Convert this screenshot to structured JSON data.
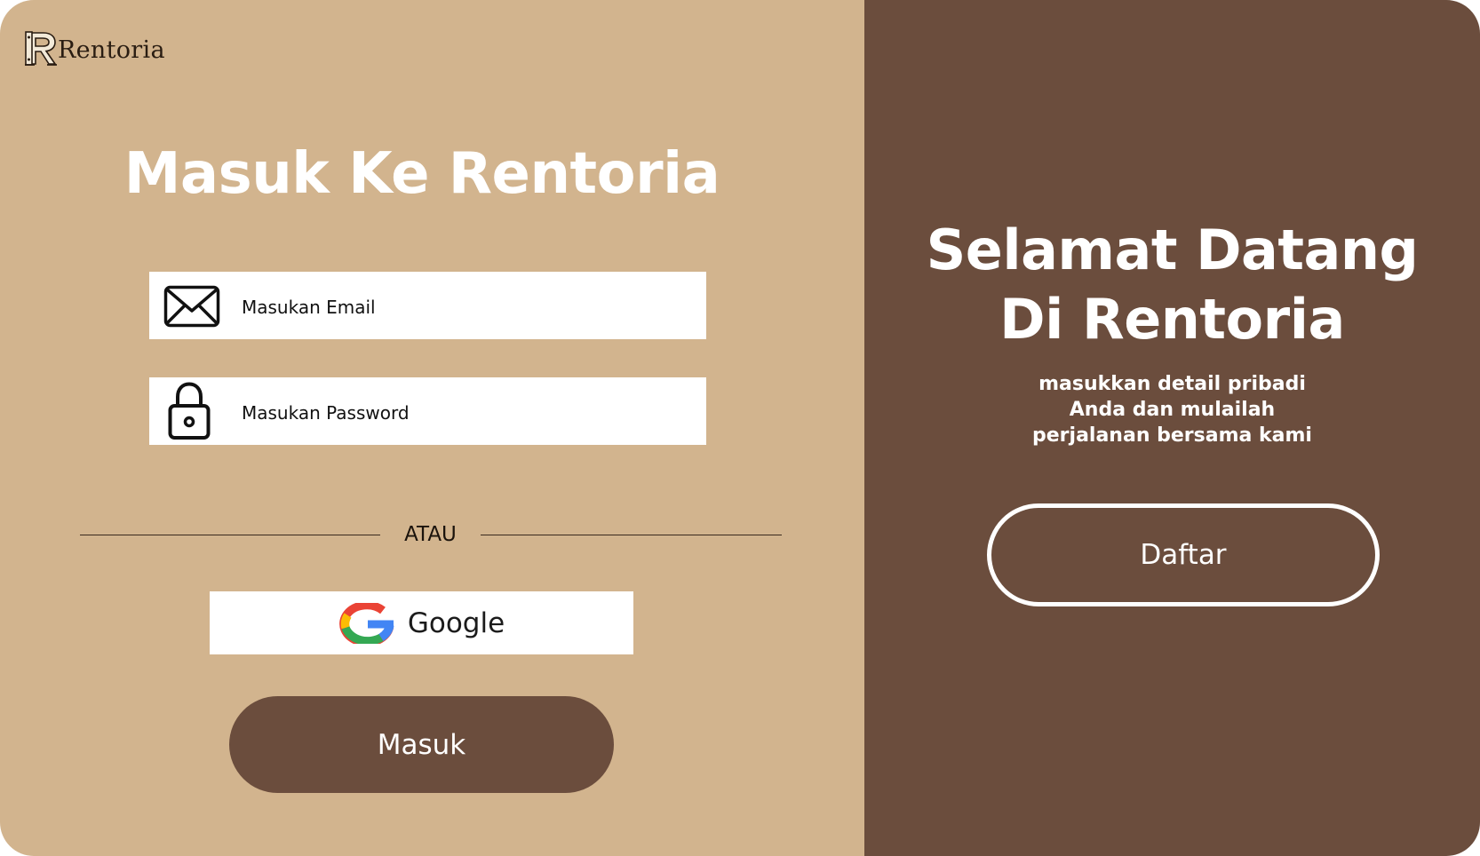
{
  "brand": {
    "name": "Rentoria",
    "logo_icon": "rentoria-r-monogram-icon"
  },
  "login": {
    "title": "Masuk Ke Rentoria",
    "email": {
      "placeholder": "Masukan Email",
      "icon": "envelope-icon"
    },
    "password": {
      "placeholder": "Masukan Password",
      "icon": "lock-icon"
    },
    "divider_text": "ATAU",
    "google": {
      "label": "Google",
      "icon": "google-g-icon"
    },
    "submit_label": "Masuk"
  },
  "welcome": {
    "title_line1": "Selamat Datang",
    "title_line2": "Di Rentoria",
    "subtitle_lines": [
      "masukkan detail pribadi",
      "Anda dan mulailah",
      "perjalanan bersama kami"
    ],
    "register_label": "Daftar"
  },
  "colors": {
    "left_panel_bg": "#D2B48E",
    "right_panel_bg": "#6B4D3D",
    "primary_button": "#6B4D3D",
    "text_on_dark": "#FFFFFF"
  }
}
